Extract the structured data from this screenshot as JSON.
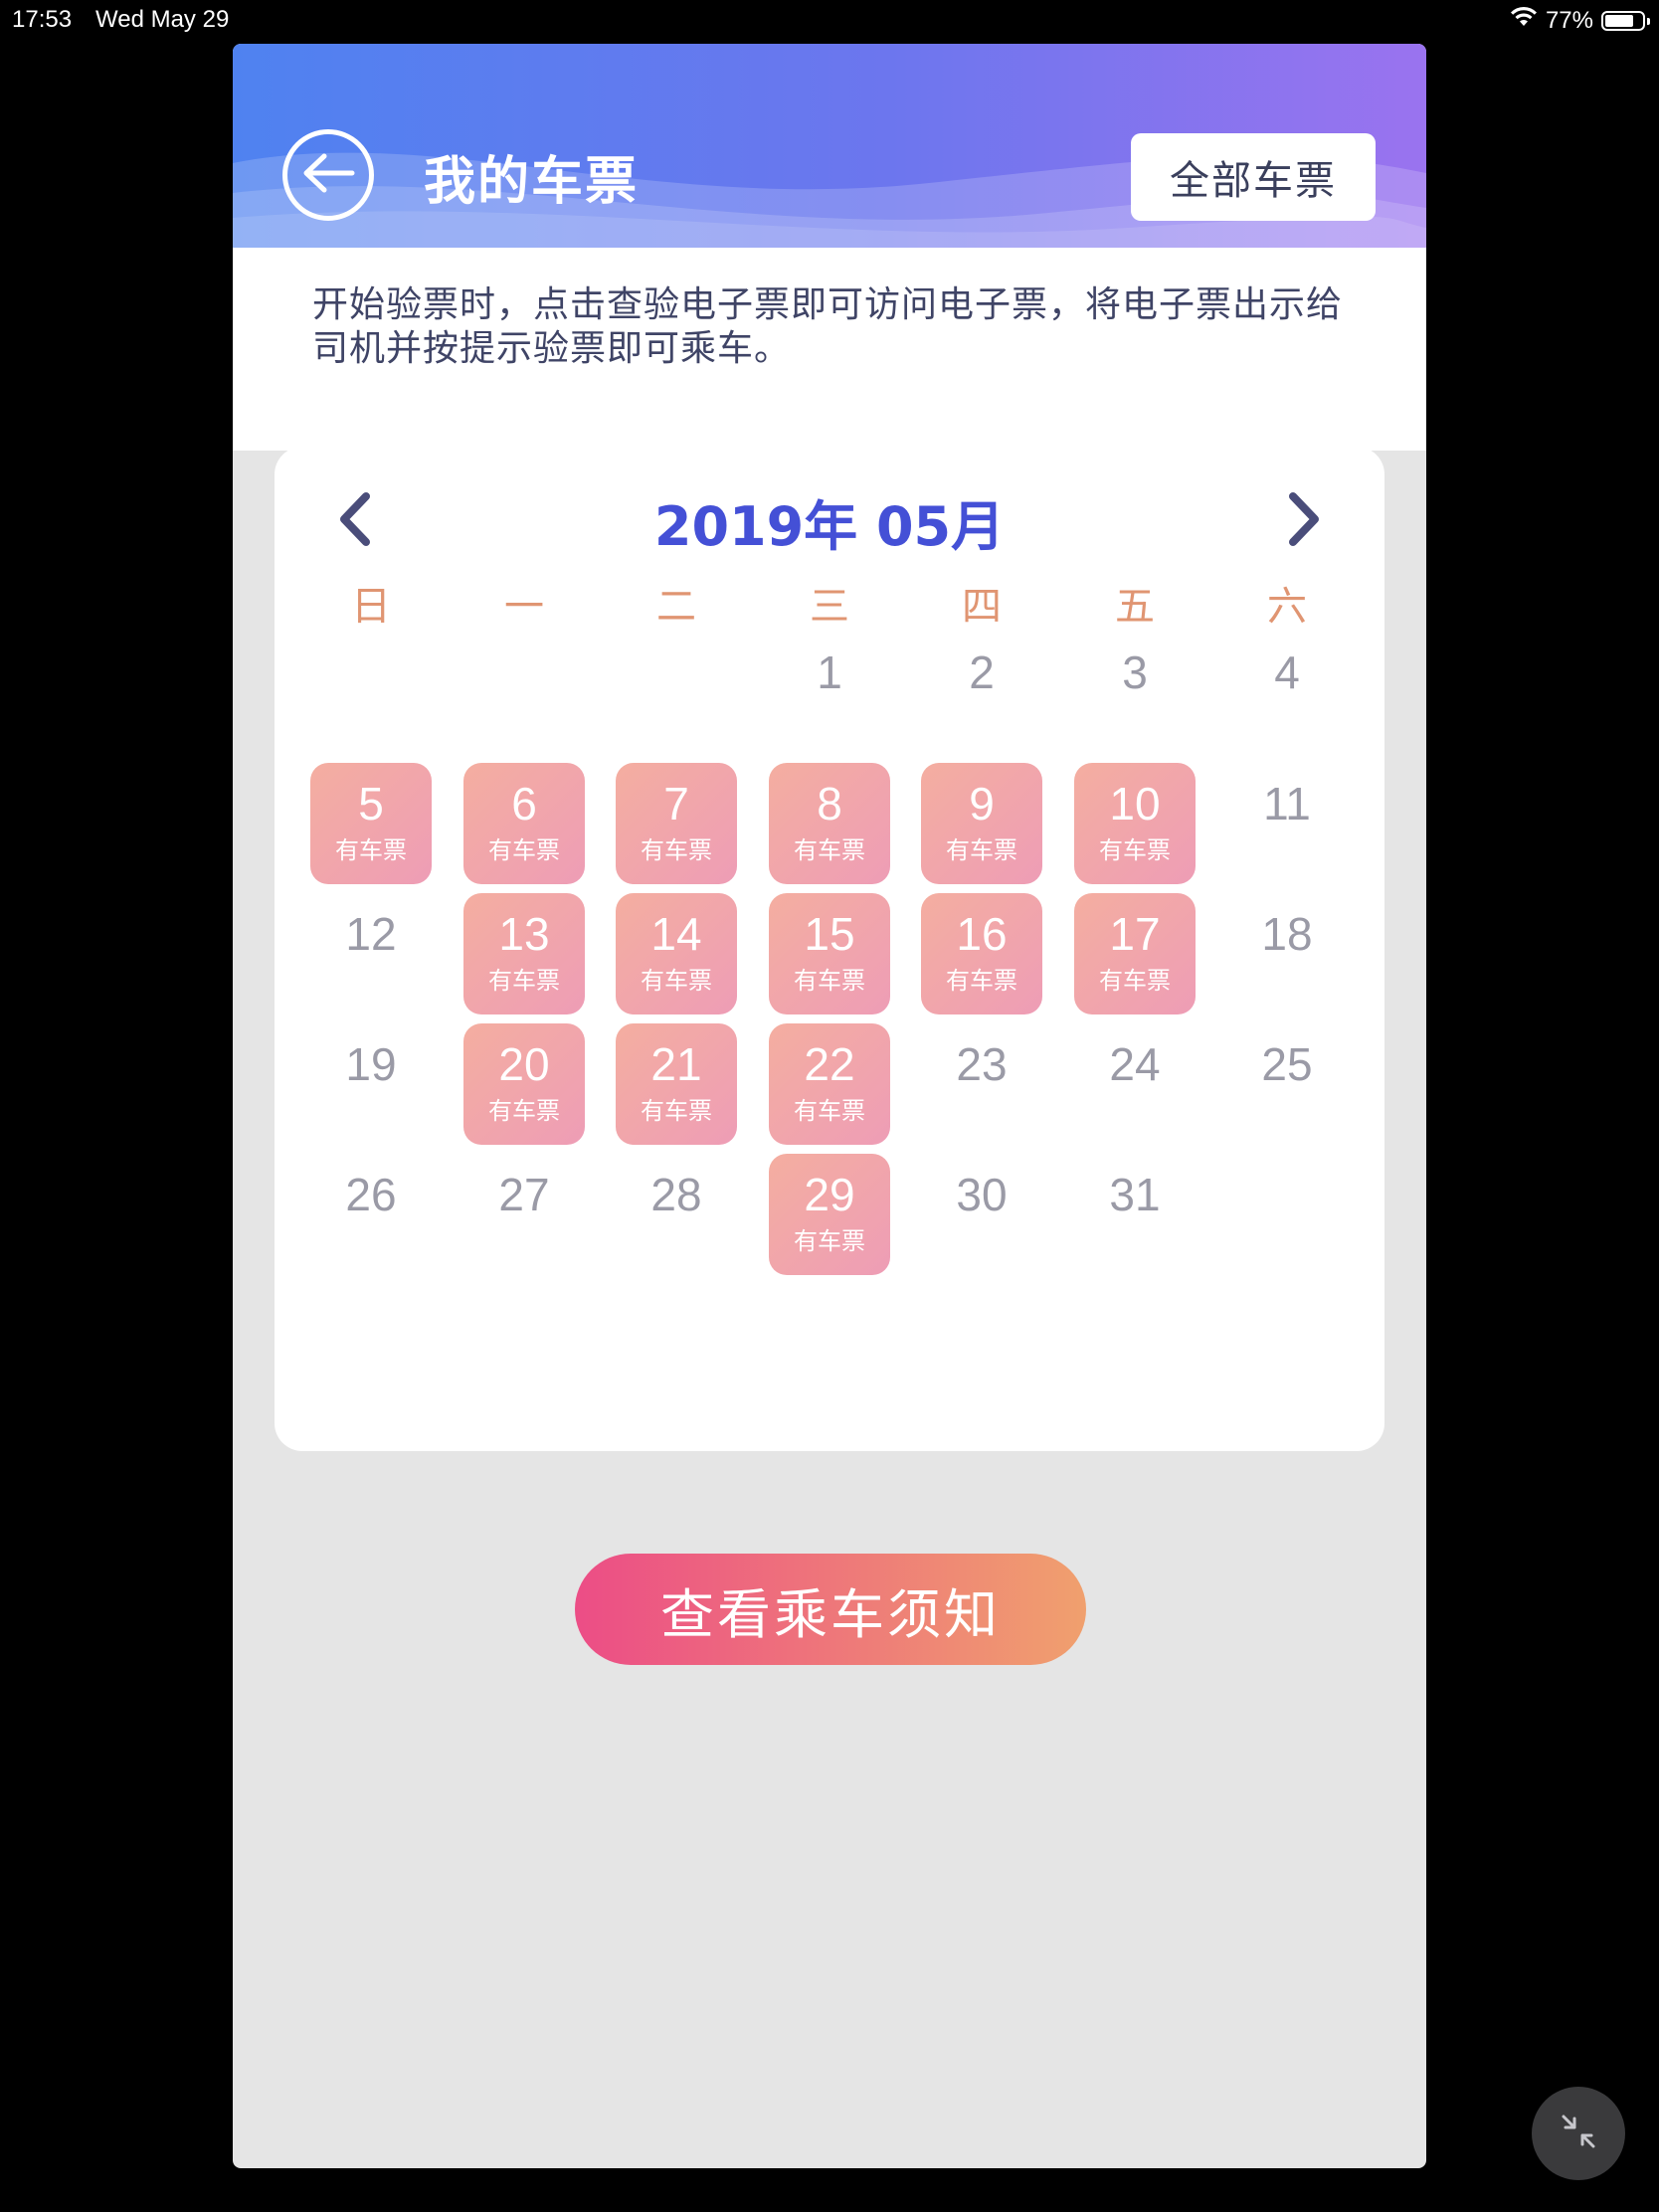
{
  "status_bar": {
    "time": "17:53",
    "date": "Wed May 29",
    "battery": "77%",
    "battery_level": 0.77,
    "wifi_icon": "wifi-icon"
  },
  "header": {
    "back_icon": "back-arrow-icon",
    "title": "我的车票",
    "all_tickets_label": "全部车票"
  },
  "notice": {
    "text": "开始验票时，点击查验电子票即可访问电子票，将电子票出示给司机并按提示验票即可乘车。"
  },
  "calendar": {
    "title": "2019年 05月",
    "prev_icon": "chevron-left-icon",
    "next_icon": "chevron-right-icon",
    "weekdays": [
      "日",
      "一",
      "二",
      "三",
      "四",
      "五",
      "六"
    ],
    "ticket_tag": "有车票",
    "first_weekday_index": 3,
    "days": [
      {
        "day": "1",
        "ticket": false
      },
      {
        "day": "2",
        "ticket": false
      },
      {
        "day": "3",
        "ticket": false
      },
      {
        "day": "4",
        "ticket": false
      },
      {
        "day": "5",
        "ticket": true
      },
      {
        "day": "6",
        "ticket": true
      },
      {
        "day": "7",
        "ticket": true
      },
      {
        "day": "8",
        "ticket": true
      },
      {
        "day": "9",
        "ticket": true
      },
      {
        "day": "10",
        "ticket": true
      },
      {
        "day": "11",
        "ticket": false
      },
      {
        "day": "12",
        "ticket": false
      },
      {
        "day": "13",
        "ticket": true
      },
      {
        "day": "14",
        "ticket": true
      },
      {
        "day": "15",
        "ticket": true
      },
      {
        "day": "16",
        "ticket": true
      },
      {
        "day": "17",
        "ticket": true
      },
      {
        "day": "18",
        "ticket": false
      },
      {
        "day": "19",
        "ticket": false
      },
      {
        "day": "20",
        "ticket": true
      },
      {
        "day": "21",
        "ticket": true
      },
      {
        "day": "22",
        "ticket": true
      },
      {
        "day": "23",
        "ticket": false
      },
      {
        "day": "24",
        "ticket": false
      },
      {
        "day": "25",
        "ticket": false
      },
      {
        "day": "26",
        "ticket": false
      },
      {
        "day": "27",
        "ticket": false
      },
      {
        "day": "28",
        "ticket": false
      },
      {
        "day": "29",
        "ticket": true
      },
      {
        "day": "30",
        "ticket": false
      },
      {
        "day": "31",
        "ticket": false
      }
    ]
  },
  "footer": {
    "notice_button_label": "查看乘车须知",
    "minimize_icon": "minimize-icon"
  },
  "colors": {
    "header_start": "#4f82f0",
    "header_end": "#9a73ef",
    "calendar_title": "#4450d6",
    "weekday": "#e09572",
    "ticket_start": "#f4aea0",
    "ticket_end": "#ee9db6",
    "button_start": "#ec4d86",
    "button_end": "#f0a06e"
  }
}
